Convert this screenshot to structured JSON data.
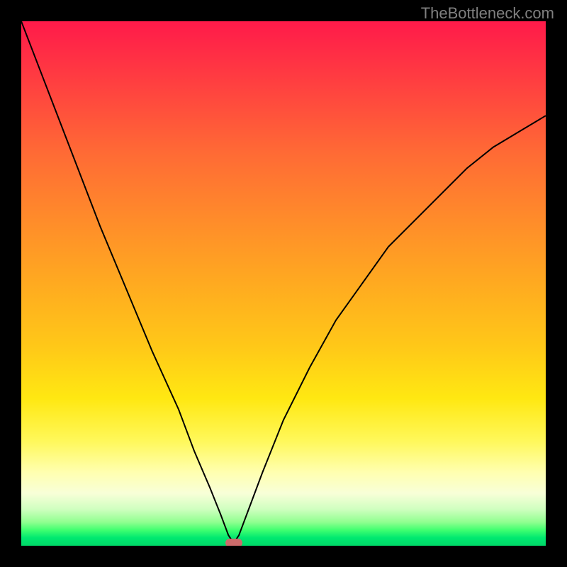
{
  "watermark": "TheBottleneck.com",
  "chart_data": {
    "type": "line",
    "title": "",
    "xlabel": "",
    "ylabel": "",
    "xlim": [
      0,
      100
    ],
    "ylim": [
      0,
      100
    ],
    "grid": false,
    "legend": false,
    "background": "red-to-green vertical gradient (bottleneck severity heatmap)",
    "series": [
      {
        "name": "bottleneck-curve",
        "x": [
          0,
          5,
          10,
          15,
          20,
          25,
          30,
          33,
          36,
          38,
          39.5,
          40.5,
          41.5,
          43,
          46,
          50,
          55,
          60,
          65,
          70,
          75,
          80,
          85,
          90,
          95,
          100
        ],
        "y": [
          100,
          87,
          74,
          61,
          49,
          37,
          26,
          18,
          11,
          6,
          2,
          0.5,
          2,
          6,
          14,
          24,
          34,
          43,
          50,
          57,
          62,
          67,
          72,
          76,
          79,
          82
        ]
      }
    ],
    "marker": {
      "name": "optimal-point",
      "x": 40.5,
      "y": 0.5,
      "color": "#cc6b6b"
    }
  }
}
